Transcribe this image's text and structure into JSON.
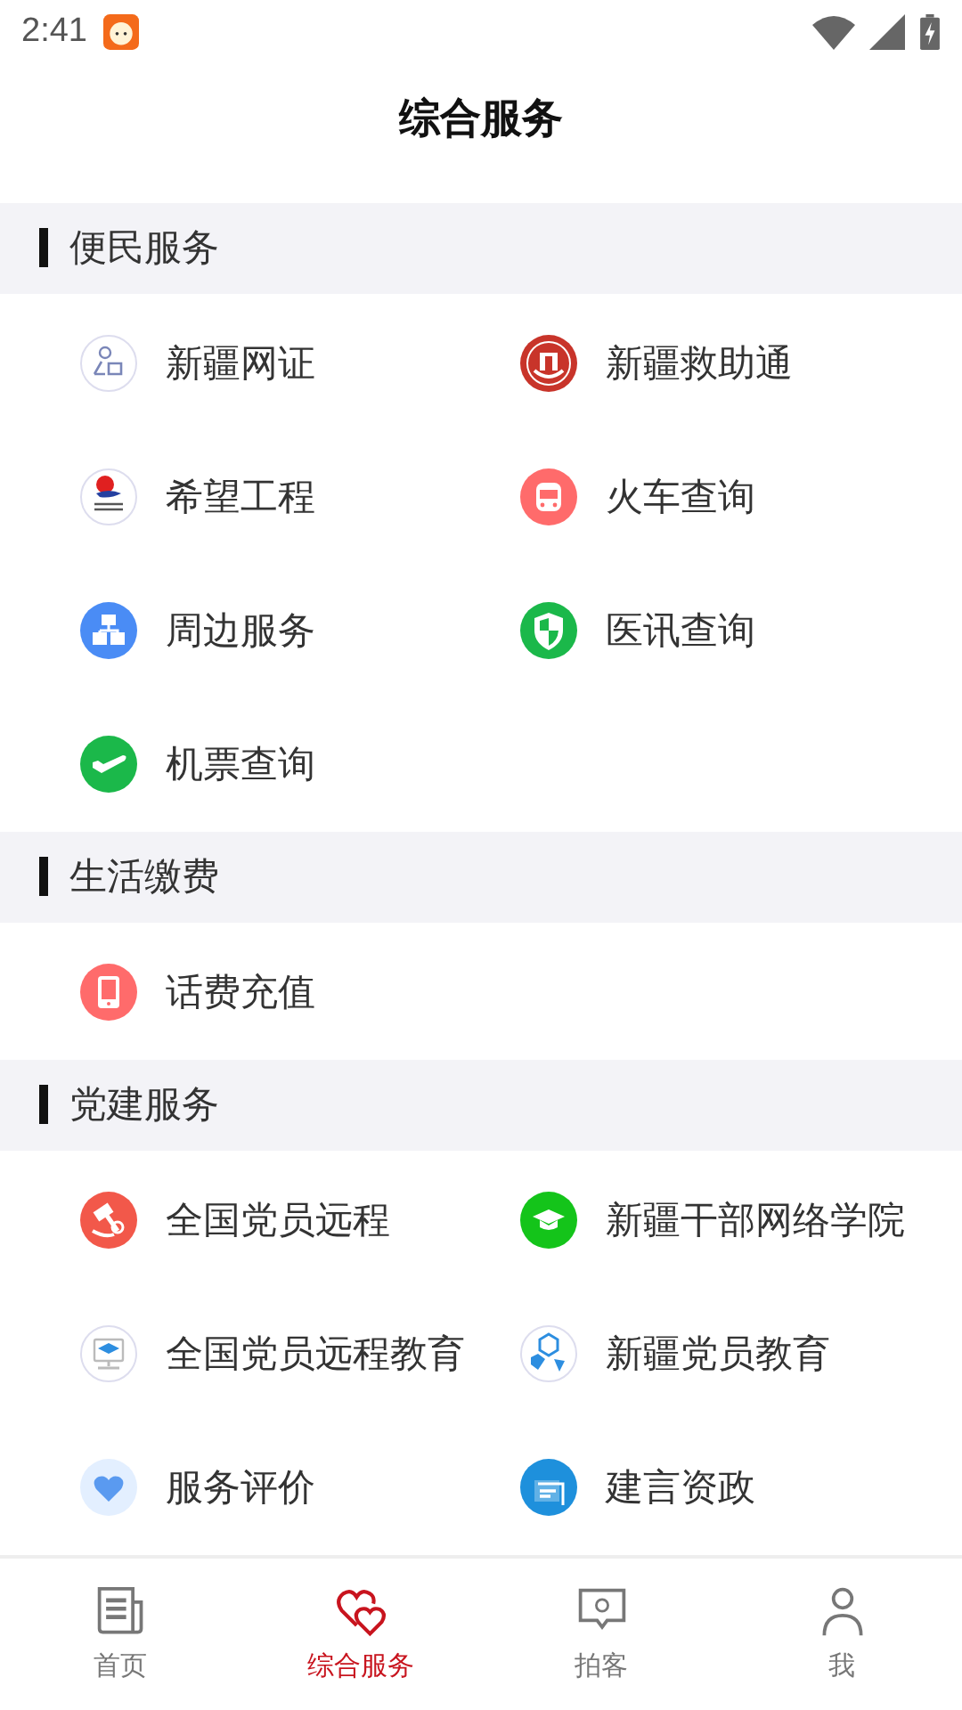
{
  "status_bar": {
    "time": "2:41"
  },
  "title": "综合服务",
  "sections": [
    {
      "title": "便民服务",
      "items": [
        {
          "label": "新疆网证"
        },
        {
          "label": "新疆救助通"
        },
        {
          "label": "希望工程"
        },
        {
          "label": "火车查询"
        },
        {
          "label": "周边服务"
        },
        {
          "label": "医讯查询"
        },
        {
          "label": "机票查询"
        }
      ]
    },
    {
      "title": "生活缴费",
      "items": [
        {
          "label": "话费充值"
        }
      ]
    },
    {
      "title": "党建服务",
      "items": [
        {
          "label": "全国党员远程"
        },
        {
          "label": "新疆干部网络学院"
        },
        {
          "label": "全国党员远程教育"
        },
        {
          "label": "新疆党员教育"
        },
        {
          "label": "服务评价"
        },
        {
          "label": "建言资政"
        }
      ]
    }
  ],
  "nav": [
    {
      "label": "首页",
      "selected": false
    },
    {
      "label": "综合服务",
      "selected": true
    },
    {
      "label": "拍客",
      "selected": false
    },
    {
      "label": "我",
      "selected": false
    }
  ]
}
